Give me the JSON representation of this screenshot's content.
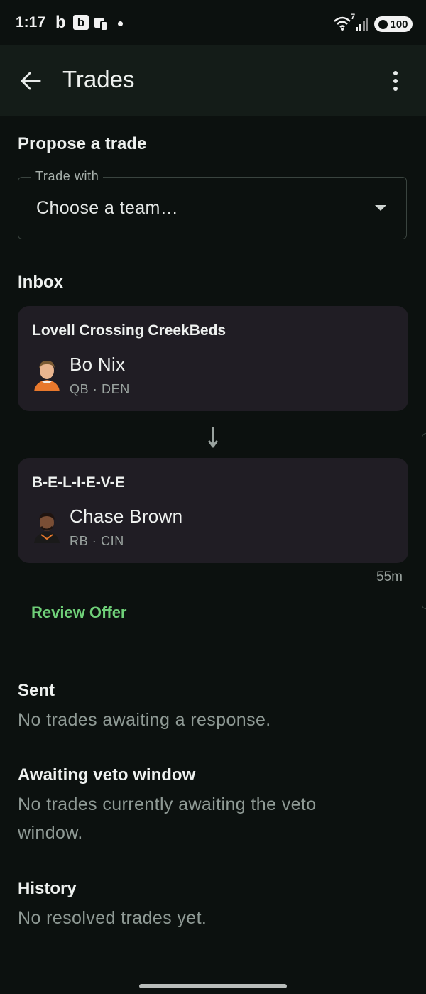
{
  "status_bar": {
    "time": "1:17",
    "battery": "100",
    "icons": [
      "b-app-icon",
      "b-box-app-icon",
      "device-icon",
      "dot-indicator",
      "wifi-icon",
      "signal-icon",
      "battery-icon"
    ],
    "network_badge": "7"
  },
  "app_bar": {
    "title": "Trades",
    "back_icon": "arrow-left-icon",
    "menu_icon": "more-vertical-icon"
  },
  "propose": {
    "heading": "Propose a trade",
    "field_label": "Trade with",
    "placeholder": "Choose a team…",
    "caret_icon": "caret-down-icon"
  },
  "inbox": {
    "heading": "Inbox",
    "offer": {
      "from": {
        "team": "Lovell Crossing CreekBeds",
        "player": "Bo Nix",
        "position": "QB · DEN"
      },
      "to": {
        "team": "B-E-L-I-E-V-E",
        "player": "Chase Brown",
        "position": "RB · CIN"
      },
      "arrow_icon": "arrow-down-icon",
      "time": "55m",
      "review_label": "Review Offer"
    }
  },
  "sent": {
    "heading": "Sent",
    "empty": "No trades awaiting a response."
  },
  "veto": {
    "heading": "Awaiting veto window",
    "empty": "No trades currently awaiting the veto window."
  },
  "history": {
    "heading": "History",
    "empty": "No resolved trades yet."
  },
  "colors": {
    "background": "#0c110f",
    "app_bar": "#141c18",
    "card": "#201d24",
    "accent_green": "#6fcf78",
    "muted_text": "#8f9a95"
  }
}
